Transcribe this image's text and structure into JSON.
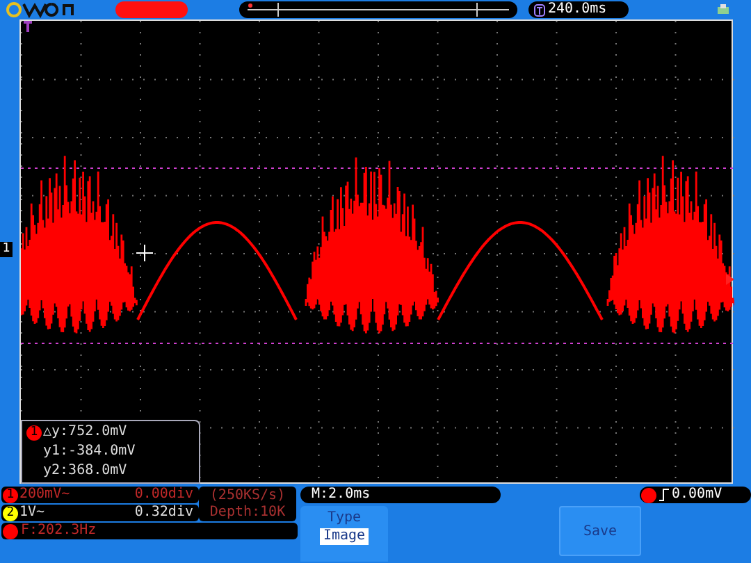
{
  "header": {
    "trigger_position": "240.0ms"
  },
  "channel_marker": "1",
  "measurement": {
    "channel": "1",
    "color": "#ff0000",
    "lines": [
      "△y:752.0mV",
      "y1:-384.0mV",
      "y2:368.0mV"
    ]
  },
  "channels": [
    {
      "number": "1",
      "color": "#ff0000",
      "scale": "200mV~",
      "offset": "0.00div"
    },
    {
      "number": "2",
      "color": "#ffff00",
      "scale": "1V~",
      "offset": "0.32div"
    }
  ],
  "frequency": {
    "color": "#ff0000",
    "text": "F:202.3Hz"
  },
  "acquisition": {
    "rate": "(250KS/s)",
    "depth": "Depth:10K"
  },
  "horizontal": {
    "timebase": "M:2.0ms"
  },
  "trigger": {
    "color": "#ff0000",
    "level": "0.00mV"
  },
  "menu": [
    {
      "kind": "selector",
      "label": "Type",
      "value": "Image"
    },
    {
      "kind": "spacer"
    },
    {
      "kind": "button",
      "label": "Save"
    }
  ]
}
